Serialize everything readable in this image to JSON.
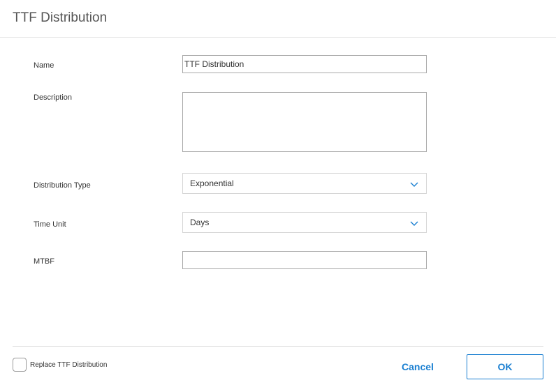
{
  "dialog": {
    "title": "TTF Distribution"
  },
  "form": {
    "name": {
      "label": "Name",
      "value": "TTF Distribution"
    },
    "description": {
      "label": "Description",
      "value": ""
    },
    "distribution_type": {
      "label": "Distribution Type",
      "value": "Exponential",
      "icon": "chevron-down-icon"
    },
    "time_unit": {
      "label": "Time Unit",
      "value": "Days",
      "icon": "chevron-down-icon"
    },
    "mtbf": {
      "label": "MTBF",
      "value": ""
    }
  },
  "footer": {
    "replace_label": "Replace TTF Distribution",
    "replace_checked": false,
    "cancel_label": "Cancel",
    "ok_label": "OK"
  },
  "colors": {
    "accent": "#1a7fd1",
    "border": "#a8a8a8",
    "divider": "#d9d9d9"
  }
}
